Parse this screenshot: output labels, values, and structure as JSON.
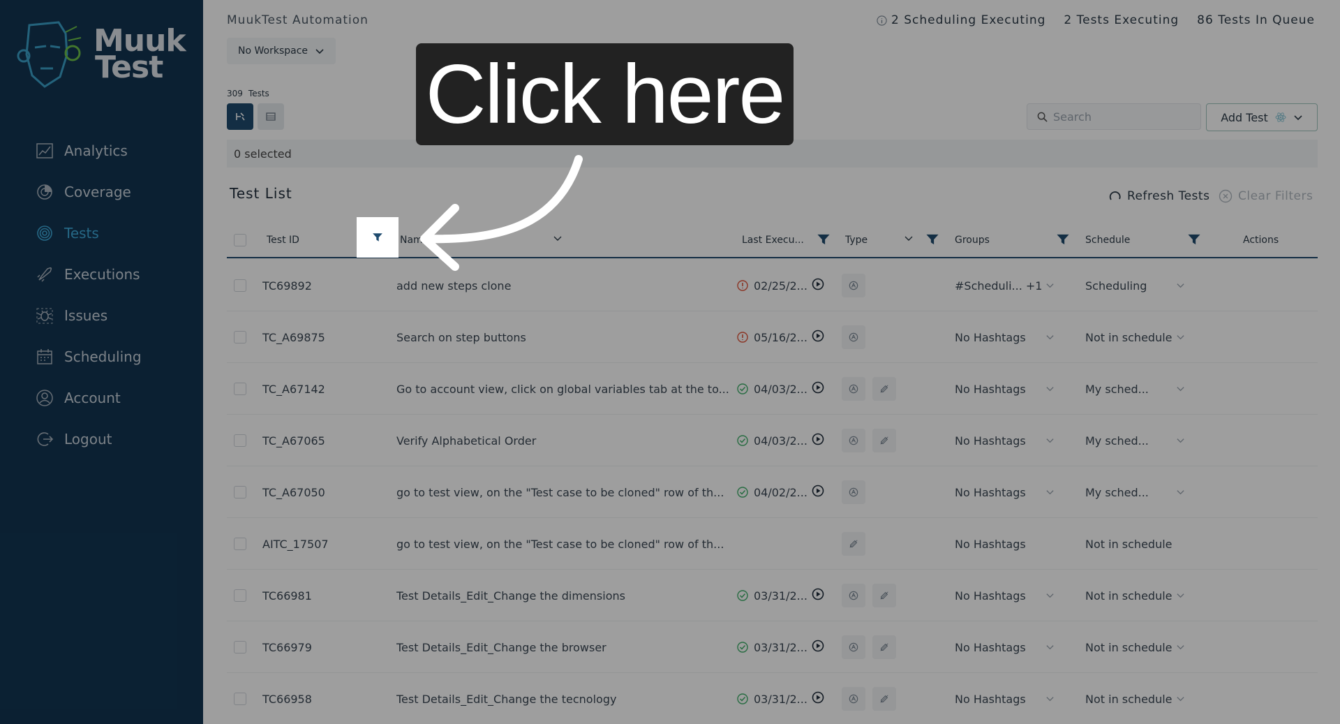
{
  "sidebar": {
    "logo_text_line1": "Muuk",
    "logo_text_line2": "Test",
    "items": [
      {
        "label": "Analytics",
        "icon": "analytics-icon"
      },
      {
        "label": "Coverage",
        "icon": "coverage-icon"
      },
      {
        "label": "Tests",
        "icon": "tests-icon",
        "active": true
      },
      {
        "label": "Executions",
        "icon": "rocket-icon"
      },
      {
        "label": "Issues",
        "icon": "bug-icon"
      },
      {
        "label": "Scheduling",
        "icon": "calendar-icon"
      },
      {
        "label": "Account",
        "icon": "user-icon"
      },
      {
        "label": "Logout",
        "icon": "logout-icon"
      }
    ]
  },
  "header": {
    "app_title": "MuukTest Automation",
    "stats": {
      "scheduling": "2 Scheduling Executing",
      "tests_executing": "2 Tests Executing",
      "queue": "86 Tests In Queue"
    },
    "workspace": "No Workspace"
  },
  "toolbar": {
    "count_number": "309",
    "count_label": "Tests",
    "search_placeholder": "Search",
    "add_test_label": "Add Test",
    "selected_text": "0 selected"
  },
  "list": {
    "title": "Test List",
    "refresh_label": "Refresh Tests",
    "clear_label": "Clear Filters",
    "columns": {
      "id": "Test ID",
      "name": "Nam",
      "last_exec": "Last Execu...",
      "type": "Type",
      "groups": "Groups",
      "schedule": "Schedule",
      "actions": "Actions"
    },
    "rows": [
      {
        "id": "TC69892",
        "name": "add new steps clone",
        "status": "error",
        "date": "02/25/2...",
        "types": [
          "auto"
        ],
        "groups": "#Scheduli...  +1 ...",
        "schedule": "Scheduling",
        "has_chev": true
      },
      {
        "id": "TC_A69875",
        "name": "Search on step buttons",
        "status": "error",
        "date": "05/16/2...",
        "types": [
          "auto"
        ],
        "groups": "No Hashtags",
        "schedule": "Not in schedule",
        "has_chev": true
      },
      {
        "id": "TC_A67142",
        "name": "Go to account view, click on global variables tab at the to...",
        "status": "ok",
        "date": "04/03/2...",
        "types": [
          "auto",
          "manual"
        ],
        "groups": "No Hashtags",
        "schedule": "My sched...",
        "has_chev": true
      },
      {
        "id": "TC_A67065",
        "name": "Verify Alphabetical Order",
        "status": "ok",
        "date": "04/03/2...",
        "types": [
          "auto",
          "manual"
        ],
        "groups": "No Hashtags",
        "schedule": "My sched...",
        "has_chev": true
      },
      {
        "id": "TC_A67050",
        "name": "go to test view, on the \"Test case to be cloned\" row of th...",
        "status": "ok",
        "date": "04/02/2...",
        "types": [
          "auto"
        ],
        "groups": "No Hashtags",
        "schedule": "My sched...",
        "has_chev": true
      },
      {
        "id": "AITC_17507",
        "name": "go to test view, on the \"Test case to be cloned\" row of th...",
        "status": "none",
        "date": "",
        "types": [
          "manual"
        ],
        "groups": "No Hashtags",
        "schedule": "Not in schedule",
        "has_chev": false
      },
      {
        "id": "TC66981",
        "name": "Test Details_Edit_Change the dimensions",
        "status": "ok",
        "date": "03/31/2...",
        "types": [
          "auto",
          "manual"
        ],
        "groups": "No Hashtags",
        "schedule": "Not in schedule",
        "has_chev": true
      },
      {
        "id": "TC66979",
        "name": "Test Details_Edit_Change the browser",
        "status": "ok",
        "date": "03/31/2...",
        "types": [
          "auto",
          "manual"
        ],
        "groups": "No Hashtags",
        "schedule": "Not in schedule",
        "has_chev": true
      },
      {
        "id": "TC66958",
        "name": "Test Details_Edit_Change the tecnology",
        "status": "ok",
        "date": "03/31/2...",
        "types": [
          "auto",
          "manual"
        ],
        "groups": "No Hashtags",
        "schedule": "Not in schedule",
        "has_chev": true
      }
    ]
  },
  "overlay": {
    "callout_text": "Click here"
  },
  "colors": {
    "sidebar_bg": "#123552",
    "active": "#3ea8d8",
    "accent_dark": "#1f4b6e",
    "status_ok": "#3fae6a",
    "status_error": "#e0553a"
  }
}
